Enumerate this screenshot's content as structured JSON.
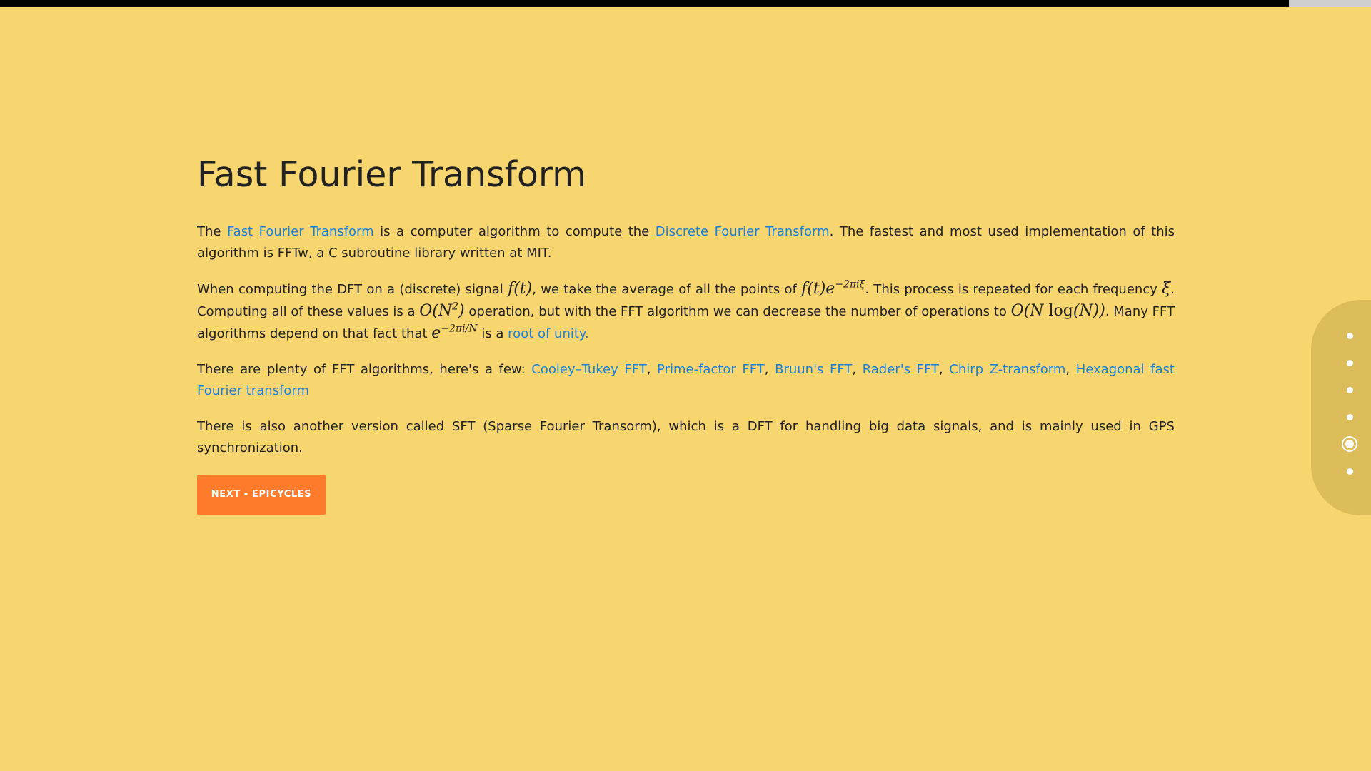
{
  "progress": {
    "fraction": 0.94
  },
  "page": {
    "title": "Fast Fourier Transform",
    "p1": {
      "t1": "The ",
      "link1": "Fast Fourier Transform",
      "t2": " is a computer algorithm to compute the ",
      "link2": "Discrete Fourier Transform",
      "t3": ". The fastest and most used implementation of this algorithm is FFTw, a C subroutine library written at MIT."
    },
    "p2": {
      "t1": "When computing the DFT on a (discrete) signal ",
      "m1": "f(t)",
      "t2": ", we take the average of all the points of ",
      "m2": "f(t)e",
      "m2_exp": "−2πiξ",
      "t3": ". This process is repeated for each frequency ",
      "m3": "ξ",
      "t4": ". Computing all of these values is a ",
      "m4": "O(N",
      "m4_exp": "2",
      "m4_end": ")",
      "t5": " operation, but with the FFT algorithm we can decrease the number of operations to ",
      "m5_a": "O(N ",
      "m5_log": "log",
      "m5_b": "(N))",
      "t6": ". Many FFT algorithms depend on that fact that ",
      "m6": "e",
      "m6_exp": "−2πi/N",
      "t7": " is a ",
      "link1": "root of unity."
    },
    "p3": {
      "t1": "There are plenty of FFT algorithms, here's a few: ",
      "links": [
        "Cooley–Tukey FFT",
        "Prime-factor FFT",
        "Bruun's FFT",
        "Rader's FFT",
        "Chirp Z-transform",
        "Hexagonal fast Fourier transform"
      ],
      "sep": ", "
    },
    "p4": "There is also another version called SFT (Sparse Fourier Transorm), which is a DFT for handling big data signals, and is mainly used in GPS synchronization.",
    "next_button": "NEXT - EPICYCLES"
  },
  "side_nav": {
    "count": 6,
    "active_index": 4
  },
  "colors": {
    "background": "#f7d66f",
    "link": "#1a7fd8",
    "button": "#fe7b2c",
    "side_nav": "#ddbc5a"
  }
}
